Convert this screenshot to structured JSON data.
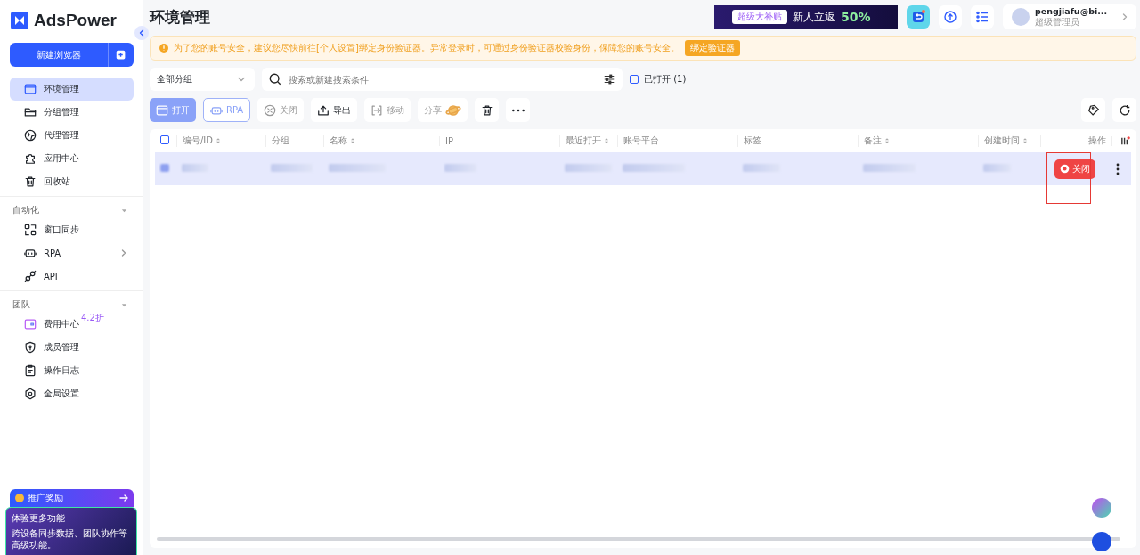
{
  "sidebar": {
    "logo": "AdsPower",
    "new_button": "新建浏览器",
    "items": [
      {
        "label": "环境管理",
        "selected": true
      },
      {
        "label": "分组管理",
        "selected": false
      },
      {
        "label": "代理管理",
        "selected": false
      },
      {
        "label": "应用中心",
        "selected": false
      },
      {
        "label": "回收站",
        "selected": false
      }
    ],
    "sections": [
      {
        "title": "自动化",
        "items": [
          {
            "label": "窗口同步",
            "selected": false,
            "arrow": false
          },
          {
            "label": "RPA",
            "selected": false,
            "arrow": true
          },
          {
            "label": "API",
            "selected": false,
            "arrow": false
          }
        ]
      },
      {
        "title": "团队",
        "items": [
          {
            "label": "费用中心",
            "selected": false,
            "arrow": false,
            "badge": "4.2折"
          },
          {
            "label": "成员管理",
            "selected": false,
            "arrow": false
          },
          {
            "label": "操作日志",
            "selected": false,
            "arrow": false
          },
          {
            "label": "全局设置",
            "selected": false,
            "arrow": false
          }
        ]
      }
    ],
    "promo": {
      "title": "推广奖励",
      "card_title": "体验更多功能",
      "card_text": "跨设备同步数据、团队协作等高级功能。"
    }
  },
  "header": {
    "title": "环境管理",
    "banner": {
      "tag": "超级大补贴",
      "text": "新人立返",
      "percent": "50%"
    },
    "user": {
      "name": "pengjiafu@bi...",
      "role": "超级管理员"
    }
  },
  "alert": {
    "text": "为了您的账号安全，建议您尽快前往[个人设置]绑定身份验证器。异常登录时，可通过身份验证器校验身份，保障您的账号安全。",
    "button": "绑定验证器"
  },
  "filters": {
    "group": "全部分组",
    "search_placeholder": "搜索或新建搜索条件",
    "opened_only": {
      "label": "已打开 (1)",
      "checked": false
    }
  },
  "toolbar": [
    {
      "kind": "primary",
      "label": "打开",
      "disabled": false
    },
    {
      "kind": "outline",
      "label": "RPA",
      "disabled": false
    },
    {
      "kind": "plain",
      "label": "关闭",
      "disabled": true
    },
    {
      "kind": "plain",
      "label": "导出",
      "disabled": false
    },
    {
      "kind": "plain",
      "label": "移动",
      "disabled": true
    },
    {
      "kind": "share",
      "label": "分享",
      "disabled": true
    },
    {
      "kind": "icon",
      "disabled": false
    },
    {
      "kind": "icon",
      "disabled": false
    }
  ],
  "table": {
    "all_checked": false,
    "columns": [
      {
        "label": "编号/ID",
        "sortable": true
      },
      {
        "label": "分组",
        "sortable": false
      },
      {
        "label": "名称",
        "sortable": true
      },
      {
        "label": "IP",
        "sortable": false
      },
      {
        "label": "最近打开",
        "sortable": true
      },
      {
        "label": "账号平台",
        "sortable": false
      },
      {
        "label": "标签",
        "sortable": false
      },
      {
        "label": "备注",
        "sortable": true
      },
      {
        "label": "创建时间",
        "sortable": true
      },
      {
        "label": "操作",
        "sortable": false
      }
    ],
    "rows": [
      {
        "selected": true,
        "action": "关闭",
        "highlighted": true
      }
    ]
  }
}
